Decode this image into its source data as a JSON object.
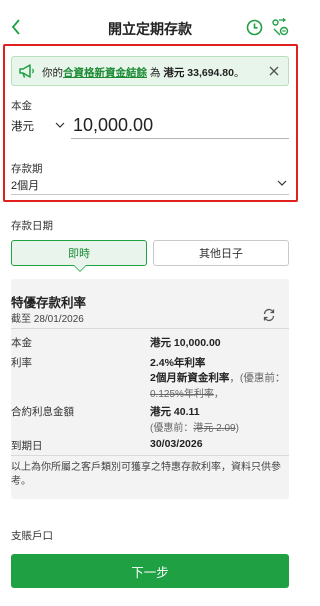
{
  "header": {
    "title": "開立定期存款"
  },
  "banner": {
    "prefix": "你的",
    "link": "合資格新資金結餘",
    "middle": "為",
    "amount": "港元 33,694.80",
    "suffix": "。"
  },
  "principal": {
    "label": "本金",
    "currency": "港元",
    "value": "10,000.00"
  },
  "term": {
    "label": "存款期",
    "value": "2個月"
  },
  "deposit_date": {
    "label": "存款日期",
    "option_now": "即時",
    "option_other": "其他日子"
  },
  "rate_card": {
    "title": "特優存款利率",
    "as_of": "截至 28/01/2026",
    "principal_label": "本金",
    "principal_value": "港元 10,000.00",
    "rate_label": "利率",
    "rate_value": "2.4%年利率",
    "rate_sub": "2個月新資金利率",
    "rate_orig_prefix": "，(優惠前：",
    "rate_orig": "0.125%年利率",
    "rate_orig_suffix": "，",
    "interest_label": "合約利息金額",
    "interest_value": "港元 40.11",
    "interest_orig_prefix": "(優惠前：",
    "interest_orig": "港元 2.09",
    "interest_orig_suffix": ")",
    "maturity_label": "到期日",
    "maturity_value": "30/03/2026",
    "note": "以上為你所屬之客戶類別可獲享之特惠存款利率，資料只供參考。"
  },
  "account": {
    "label": "支賬戶口"
  },
  "footer": {
    "next": "下一步"
  },
  "colors": {
    "brand_green": "#1ea043",
    "highlight_red": "#e0201c"
  }
}
